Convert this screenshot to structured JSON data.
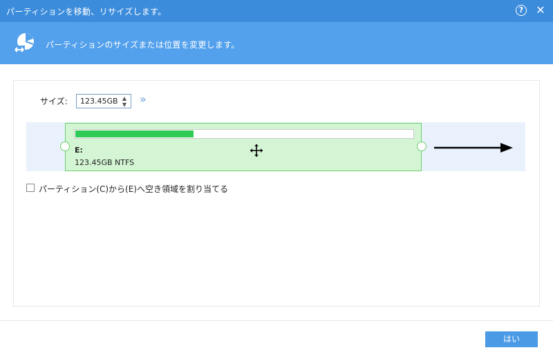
{
  "window": {
    "title": "パーティションを移動、リサイズします。",
    "help_glyph": "?",
    "close_glyph": "✕"
  },
  "banner": {
    "description": "パーティションのサイズまたは位置を変更します。",
    "icon": "partition-resize-icon"
  },
  "size": {
    "label": "サイズ:",
    "value": "123.45GB",
    "spin_up": "▲",
    "spin_down": "▼",
    "expand_glyph": "»"
  },
  "partition": {
    "drive": "E:",
    "info": "123.45GB NTFS",
    "used_fraction": 0.35,
    "fill_color": "#2fcc55",
    "bg_color": "#d4f5d4"
  },
  "option": {
    "label": "パーティション(C)から(E)へ空き領域を割り当てる",
    "checked": false
  },
  "footer": {
    "ok_label": "はい"
  },
  "colors": {
    "titlebar": "#3c8cdc",
    "banner": "#53a1ec",
    "button": "#4a9ae6"
  }
}
